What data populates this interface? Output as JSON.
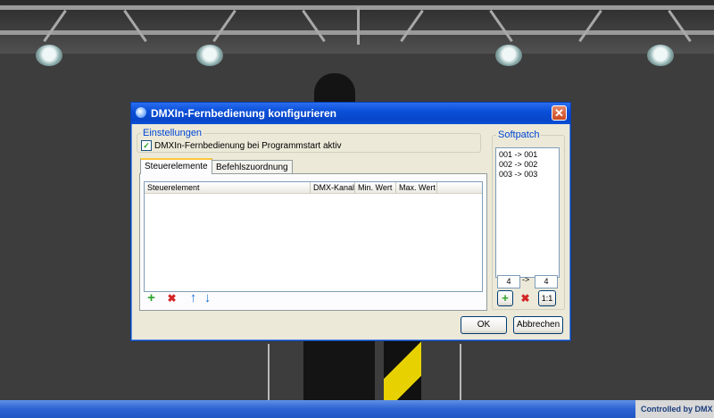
{
  "window": {
    "title": "DMXIn-Fernbedienung konfigurieren",
    "close_glyph": "✕"
  },
  "settings": {
    "legend": "Einstellungen",
    "autostart_label": "DMXIn-Fernbedienung bei Programmstart aktiv",
    "autostart_checked": true
  },
  "tabs": [
    {
      "label": "Steuerelemente",
      "active": true
    },
    {
      "label": "Befehlszuordnung",
      "active": false
    }
  ],
  "table": {
    "columns": [
      "Steuerelement",
      "DMX-Kanal",
      "Min. Wert",
      "Max. Wert"
    ],
    "rows": []
  },
  "toolbar": {
    "add_glyph": "+",
    "delete_glyph": "✖",
    "up_glyph": "↑",
    "down_glyph": "↓"
  },
  "softpatch": {
    "legend": "Softpatch",
    "items": [
      "001 -> 001",
      "002 -> 002",
      "003 -> 003"
    ],
    "from_value": "4",
    "arrow": "->",
    "to_value": "4",
    "one_to_one_label": "1:1"
  },
  "buttons": {
    "ok": "OK",
    "cancel": "Abbrechen"
  },
  "status": {
    "text": "Controlled by DMX"
  },
  "colors": {
    "titlebar": "#0a4fd8",
    "dialog_bg": "#ece9d8",
    "legend_blue": "#0046d5"
  },
  "icons": {
    "add": "plus-icon",
    "delete": "x-icon",
    "up": "arrow-up-icon",
    "down": "arrow-down-icon"
  }
}
